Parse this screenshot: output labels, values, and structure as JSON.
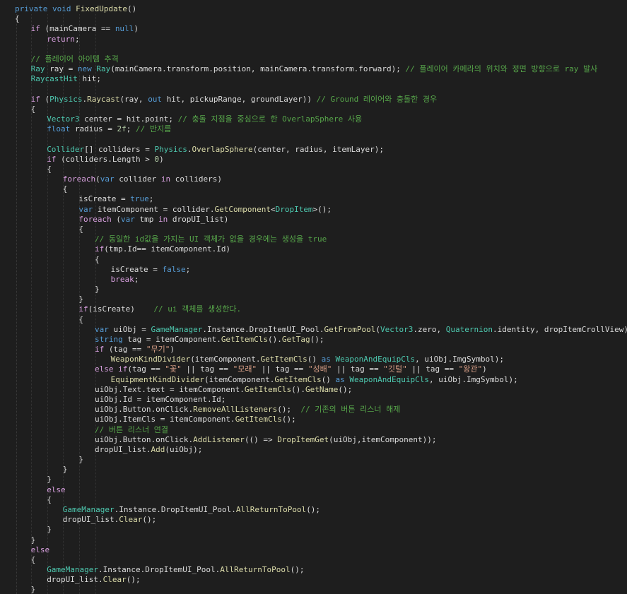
{
  "colors": {
    "background": "#1e1e1e",
    "plain": "#dcdcdc",
    "keyword": "#569cd6",
    "type": "#4ec9b0",
    "method": "#dcdcaa",
    "comment": "#57a64a",
    "string": "#d69d85",
    "number": "#b5cea8",
    "identifier": "#9cdcfe",
    "control": "#d8a0df"
  },
  "code_lines": [
    [
      [
        "kw",
        "private "
      ],
      [
        "kw",
        "void "
      ],
      [
        "me",
        "FixedUpdate"
      ],
      [
        "pl",
        "()"
      ]
    ],
    [
      [
        "pl",
        "{"
      ]
    ],
    [
      [
        "ctl",
        "if "
      ],
      [
        "pl",
        "(mainCamera == "
      ],
      [
        "kw",
        "null"
      ],
      [
        "pl",
        ")"
      ]
    ],
    [
      [
        "ctl",
        "return"
      ],
      [
        "pl",
        ";"
      ]
    ],
    [],
    [
      [
        "cm",
        "// 플레이어 아이템 추격"
      ]
    ],
    [
      [
        "ty",
        "Ray "
      ],
      [
        "pl",
        "ray = "
      ],
      [
        "kw",
        "new "
      ],
      [
        "ty",
        "Ray"
      ],
      [
        "pl",
        "(mainCamera.transform.position, mainCamera.transform.forward); "
      ],
      [
        "cm",
        "// 플레이어 카메라의 위치와 정면 방향으로 ray 발사"
      ]
    ],
    [
      [
        "ty",
        "RaycastHit "
      ],
      [
        "pl",
        "hit;"
      ]
    ],
    [],
    [
      [
        "ctl",
        "if "
      ],
      [
        "pl",
        "("
      ],
      [
        "ty",
        "Physics"
      ],
      [
        "pl",
        "."
      ],
      [
        "me",
        "Raycast"
      ],
      [
        "pl",
        "(ray, "
      ],
      [
        "kw",
        "out "
      ],
      [
        "pl",
        "hit, pickupRange, groundLayer)) "
      ],
      [
        "cm",
        "// Ground 레이어와 충돌한 경우"
      ]
    ],
    [
      [
        "pl",
        "{"
      ]
    ],
    [
      [
        "ty",
        "Vector3 "
      ],
      [
        "pl",
        "center = hit.point; "
      ],
      [
        "cm",
        "// 충돌 지점을 중심으로 한 OverlapSphere 사용"
      ]
    ],
    [
      [
        "kw",
        "float "
      ],
      [
        "pl",
        "radius = "
      ],
      [
        "nu",
        "2f"
      ],
      [
        "pl",
        "; "
      ],
      [
        "cm",
        "// 반지름"
      ]
    ],
    [],
    [
      [
        "ty",
        "Collider"
      ],
      [
        "pl",
        "[] colliders = "
      ],
      [
        "ty",
        "Physics"
      ],
      [
        "pl",
        "."
      ],
      [
        "me",
        "OverlapSphere"
      ],
      [
        "pl",
        "(center, radius, itemLayer);"
      ]
    ],
    [
      [
        "ctl",
        "if "
      ],
      [
        "pl",
        "(colliders.Length > "
      ],
      [
        "nu",
        "0"
      ],
      [
        "pl",
        ")"
      ]
    ],
    [
      [
        "pl",
        "{"
      ]
    ],
    [
      [
        "ctl",
        "foreach"
      ],
      [
        "pl",
        "("
      ],
      [
        "kw",
        "var "
      ],
      [
        "pl",
        "collider "
      ],
      [
        "ctl",
        "in "
      ],
      [
        "pl",
        "colliders)"
      ]
    ],
    [
      [
        "pl",
        "{"
      ]
    ],
    [
      [
        "pl",
        "isCreate = "
      ],
      [
        "kw",
        "true"
      ],
      [
        "pl",
        ";"
      ]
    ],
    [
      [
        "kw",
        "var "
      ],
      [
        "pl",
        "itemComponent = collider."
      ],
      [
        "me",
        "GetComponent"
      ],
      [
        "pl",
        "<"
      ],
      [
        "ty",
        "DropItem"
      ],
      [
        "pl",
        ">();"
      ]
    ],
    [
      [
        "ctl",
        "foreach "
      ],
      [
        "pl",
        "("
      ],
      [
        "kw",
        "var "
      ],
      [
        "pl",
        "tmp "
      ],
      [
        "ctl",
        "in "
      ],
      [
        "pl",
        "dropUI_list)"
      ]
    ],
    [
      [
        "pl",
        "{"
      ]
    ],
    [
      [
        "cm",
        "// 동일한 id값을 가지는 UI 객체가 없을 경우에는 생성을 true"
      ]
    ],
    [
      [
        "ctl",
        "if"
      ],
      [
        "pl",
        "(tmp.Id== itemComponent.Id)"
      ]
    ],
    [
      [
        "pl",
        "{"
      ]
    ],
    [
      [
        "pl",
        "isCreate = "
      ],
      [
        "kw",
        "false"
      ],
      [
        "pl",
        ";"
      ]
    ],
    [
      [
        "ctl",
        "break"
      ],
      [
        "pl",
        ";"
      ]
    ],
    [
      [
        "pl",
        "}"
      ]
    ],
    [
      [
        "pl",
        "}"
      ]
    ],
    [
      [
        "ctl",
        "if"
      ],
      [
        "pl",
        "(isCreate)    "
      ],
      [
        "cm",
        "// ui 객체를 생성한다."
      ]
    ],
    [
      [
        "pl",
        "{"
      ]
    ],
    [
      [
        "kw",
        "var "
      ],
      [
        "pl",
        "uiObj = "
      ],
      [
        "ty",
        "GameManager"
      ],
      [
        "pl",
        ".Instance.DropItemUI_Pool."
      ],
      [
        "me",
        "GetFromPool"
      ],
      [
        "pl",
        "("
      ],
      [
        "ty",
        "Vector3"
      ],
      [
        "pl",
        ".zero, "
      ],
      [
        "ty",
        "Quaternion"
      ],
      [
        "pl",
        ".identity, dropItemCrollView);"
      ]
    ],
    [
      [
        "kw",
        "string "
      ],
      [
        "pl",
        "tag = itemComponent."
      ],
      [
        "me",
        "GetItemCls"
      ],
      [
        "pl",
        "()."
      ],
      [
        "me",
        "GetTag"
      ],
      [
        "pl",
        "();"
      ]
    ],
    [
      [
        "ctl",
        "if "
      ],
      [
        "pl",
        "(tag == "
      ],
      [
        "st",
        "\"무기\""
      ],
      [
        "pl",
        ")"
      ]
    ],
    [
      [
        "me",
        "WeaponKindDivider"
      ],
      [
        "pl",
        "(itemComponent."
      ],
      [
        "me",
        "GetItemCls"
      ],
      [
        "pl",
        "() "
      ],
      [
        "kw",
        "as "
      ],
      [
        "ty",
        "WeaponAndEquipCls"
      ],
      [
        "pl",
        ", uiObj.ImgSymbol);"
      ]
    ],
    [
      [
        "ctl",
        "else if"
      ],
      [
        "pl",
        "(tag == "
      ],
      [
        "st",
        "\"꽃\""
      ],
      [
        "pl",
        " || tag == "
      ],
      [
        "st",
        "\"모래\""
      ],
      [
        "pl",
        " || tag == "
      ],
      [
        "st",
        "\"성배\""
      ],
      [
        "pl",
        " || tag == "
      ],
      [
        "st",
        "\"깃털\""
      ],
      [
        "pl",
        " || tag == "
      ],
      [
        "st",
        "\"왕관\""
      ],
      [
        "pl",
        ")"
      ]
    ],
    [
      [
        "me",
        "EquipmentKindDivider"
      ],
      [
        "pl",
        "(itemComponent."
      ],
      [
        "me",
        "GetItemCls"
      ],
      [
        "pl",
        "() "
      ],
      [
        "kw",
        "as "
      ],
      [
        "ty",
        "WeaponAndEquipCls"
      ],
      [
        "pl",
        ", uiObj.ImgSymbol);"
      ]
    ],
    [
      [
        "pl",
        "uiObj.Text.text = itemComponent."
      ],
      [
        "me",
        "GetItemCls"
      ],
      [
        "pl",
        "()."
      ],
      [
        "me",
        "GetName"
      ],
      [
        "pl",
        "();"
      ]
    ],
    [
      [
        "pl",
        "uiObj.Id = itemComponent.Id;"
      ]
    ],
    [
      [
        "pl",
        "uiObj.Button.onClick."
      ],
      [
        "me",
        "RemoveAllListeners"
      ],
      [
        "pl",
        "();  "
      ],
      [
        "cm",
        "// 기존의 버튼 리스너 해제"
      ]
    ],
    [
      [
        "pl",
        "uiObj.ItemCls = itemComponent."
      ],
      [
        "me",
        "GetItemCls"
      ],
      [
        "pl",
        "();"
      ]
    ],
    [
      [
        "cm",
        "// 버튼 리스너 연결"
      ]
    ],
    [
      [
        "pl",
        "uiObj.Button.onClick."
      ],
      [
        "me",
        "AddListener"
      ],
      [
        "pl",
        "(() => "
      ],
      [
        "me",
        "DropItemGet"
      ],
      [
        "pl",
        "(uiObj,itemComponent));"
      ]
    ],
    [
      [
        "pl",
        "dropUI_list."
      ],
      [
        "me",
        "Add"
      ],
      [
        "pl",
        "(uiObj);"
      ]
    ],
    [
      [
        "pl",
        "}"
      ]
    ],
    [
      [
        "pl",
        "}"
      ]
    ],
    [
      [
        "pl",
        "}"
      ]
    ],
    [
      [
        "ctl",
        "else"
      ]
    ],
    [
      [
        "pl",
        "{"
      ]
    ],
    [
      [
        "ty",
        "GameManager"
      ],
      [
        "pl",
        ".Instance.DropItemUI_Pool."
      ],
      [
        "me",
        "AllReturnToPool"
      ],
      [
        "pl",
        "();"
      ]
    ],
    [
      [
        "pl",
        "dropUI_list."
      ],
      [
        "me",
        "Clear"
      ],
      [
        "pl",
        "();"
      ]
    ],
    [
      [
        "pl",
        "}"
      ]
    ],
    [
      [
        "pl",
        "}"
      ]
    ],
    [
      [
        "ctl",
        "else"
      ]
    ],
    [
      [
        "pl",
        "{"
      ]
    ],
    [
      [
        "ty",
        "GameManager"
      ],
      [
        "pl",
        ".Instance.DropItemUI_Pool."
      ],
      [
        "me",
        "AllReturnToPool"
      ],
      [
        "pl",
        "();"
      ]
    ],
    [
      [
        "pl",
        "dropUI_list."
      ],
      [
        "me",
        "Clear"
      ],
      [
        "pl",
        "();"
      ]
    ],
    [
      [
        "pl",
        "}"
      ]
    ]
  ]
}
